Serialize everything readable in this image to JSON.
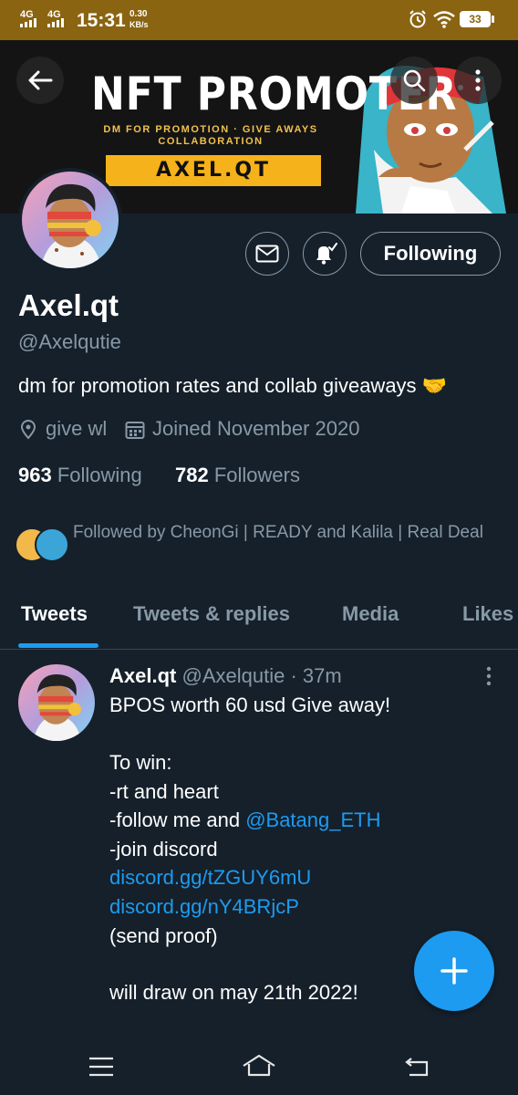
{
  "status_bar": {
    "network1": "4G",
    "network2": "4G",
    "time": "15:31",
    "speed_value": "0.30",
    "speed_unit": "KB/s",
    "battery": "33",
    "icons": [
      "alarm-icon",
      "wifi-icon",
      "battery-icon"
    ]
  },
  "banner": {
    "title": "NFT PROMOTER",
    "subtitle_line1": "DM FOR PROMOTION · GIVE AWAYS",
    "subtitle_line2": "COLLABORATION",
    "tag": "AXEL.QT",
    "icons": [
      "back-arrow-icon",
      "search-icon",
      "more-vertical-icon"
    ]
  },
  "profile": {
    "name": "Axel.qt",
    "handle": "@Axelqutie",
    "bio": "dm for promotion rates and collab giveaways",
    "bio_emoji": "🤝",
    "location": "give wl",
    "joined": "Joined November 2020",
    "following_count": "963",
    "following_label": "Following",
    "followers_count": "782",
    "followers_label": "Followers",
    "followed_by": "Followed by CheonGi | READY and Kalila | Real Deal",
    "follow_button": "Following"
  },
  "tabs": [
    {
      "label": "Tweets",
      "active": true
    },
    {
      "label": "Tweets & replies",
      "active": false
    },
    {
      "label": "Media",
      "active": false
    },
    {
      "label": "Likes",
      "active": false
    }
  ],
  "tweet": {
    "name": "Axel.qt",
    "handle": "@Axelqutie",
    "sep": "·",
    "time": "37m",
    "lines": [
      "BPOS worth 60 usd Give away!",
      "",
      "To win:",
      "-rt and heart",
      "-follow me and ",
      "-join discord",
      "discord.gg/tZGUY6mU",
      "discord.gg/nY4BRjcP",
      "(send proof)",
      "",
      "will draw on may 21th 2022!"
    ],
    "mention": "@Batang_ETH"
  },
  "colors": {
    "background": "#15202b",
    "accent": "#1d9bf0",
    "secondary_text": "#8899a6",
    "status_bar": "#8a6410"
  }
}
